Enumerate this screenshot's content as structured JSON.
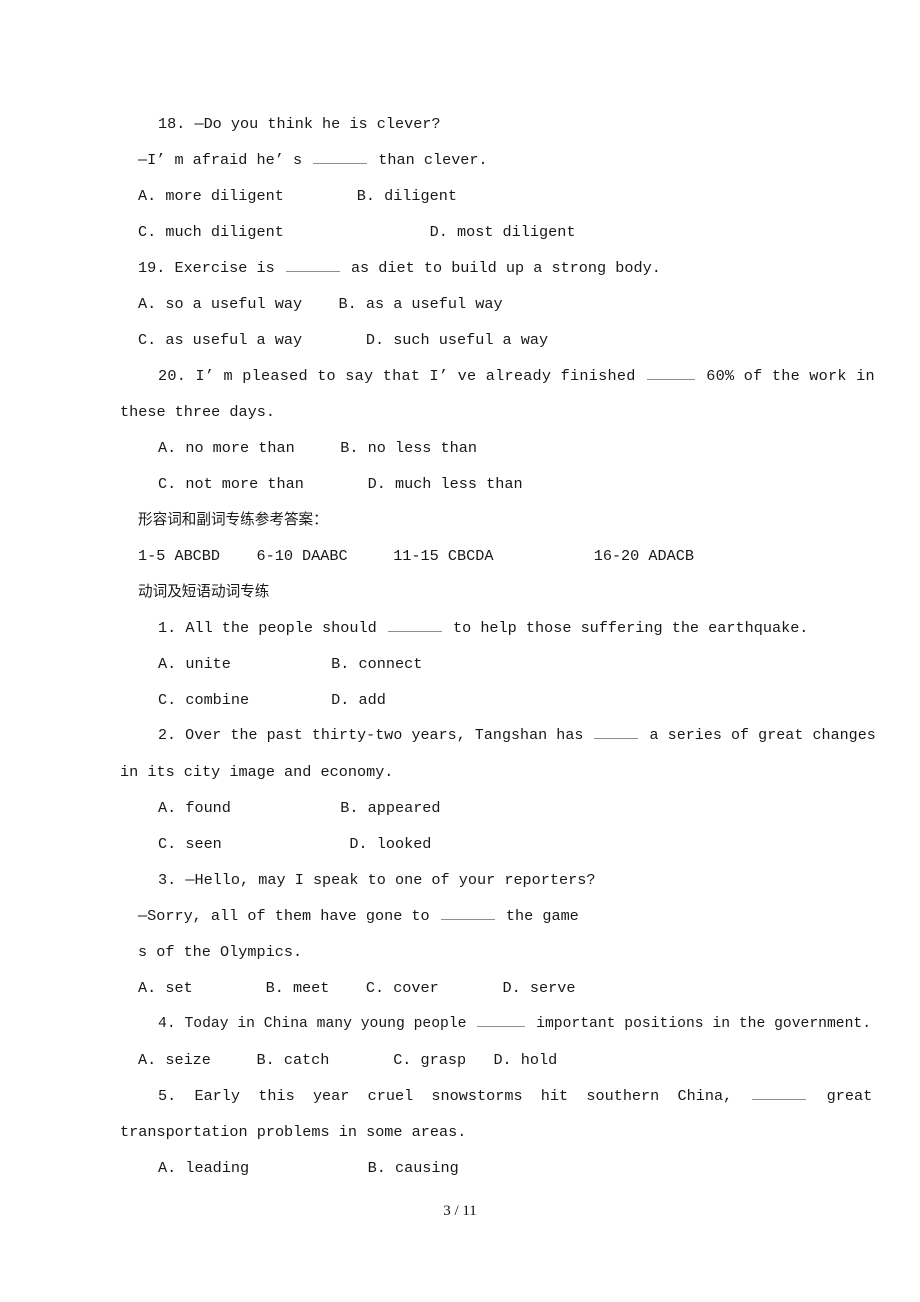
{
  "page": {
    "number_label": "3 / 11",
    "current": 3,
    "total": 11
  },
  "blank_marker": "______",
  "body": {
    "q18": {
      "stem_a": "18. —Do you think he is clever?",
      "stem_b_pre": "—I’ m afraid he’ s ",
      "stem_b_post": " than clever.",
      "opt_ab": "A. more diligent        B. diligent",
      "opt_cd": "C. much diligent                D. most diligent"
    },
    "q19": {
      "stem_pre": "19. Exercise is ",
      "stem_post": " as diet to build up a strong body.",
      "opt_ab": "A. so a useful way    B. as a useful way",
      "opt_cd": "C. as useful a way       D. such useful a way"
    },
    "q20": {
      "stem_line1_pre": "20. I’ m pleased to say that I’ ve already finished ",
      "stem_line1_post": " 60% of the work in",
      "stem_line2": "these three days.",
      "opt_ab": "A. no more than     B. no less than",
      "opt_cd": "C. not more than       D. much less than"
    },
    "answer_key_heading": "形容词和副词专练参考答案：",
    "answer_key_line": "1-5 ABCBD    6-10 DAABC     11-15 CBCDA           16-20 ADACB",
    "section_heading": "动词及短语动词专练",
    "v1": {
      "stem_pre": "1. All the people should ",
      "stem_post": " to help those suffering the earthquake.",
      "opt_ab": "A. unite           B. connect",
      "opt_cd": "C. combine         D. add"
    },
    "v2": {
      "stem_line1_pre": "2. Over the past thirty-two years, Tangshan has ",
      "stem_line1_post": " a series of great changes",
      "stem_line2": "in its city image and economy.",
      "opt_ab": "A. found            B. appeared",
      "opt_cd": "C. seen              D. looked"
    },
    "v3": {
      "stem_line1": "3. —Hello, may I speak to one of your reporters?",
      "stem_line2_pre": "—Sorry, all of them have gone to ",
      "stem_line2_post": " the game",
      "stem_line3": "s of the Olympics.",
      "opt_abcd": "A. set        B. meet    C. cover       D. serve"
    },
    "v4": {
      "stem_pre": "4. Today in China many young people ",
      "stem_post": " important positions in the government.",
      "opt_abcd": "A. seize     B. catch       C. grasp   D. hold"
    },
    "v5": {
      "stem_line1_pre": "5.  Early  this  year  cruel  snowstorms  hit  southern  China,  ",
      "stem_line1_post": "  great",
      "stem_line2": "transportation problems in some areas.",
      "opt_ab": "A. leading             B. causing"
    }
  }
}
